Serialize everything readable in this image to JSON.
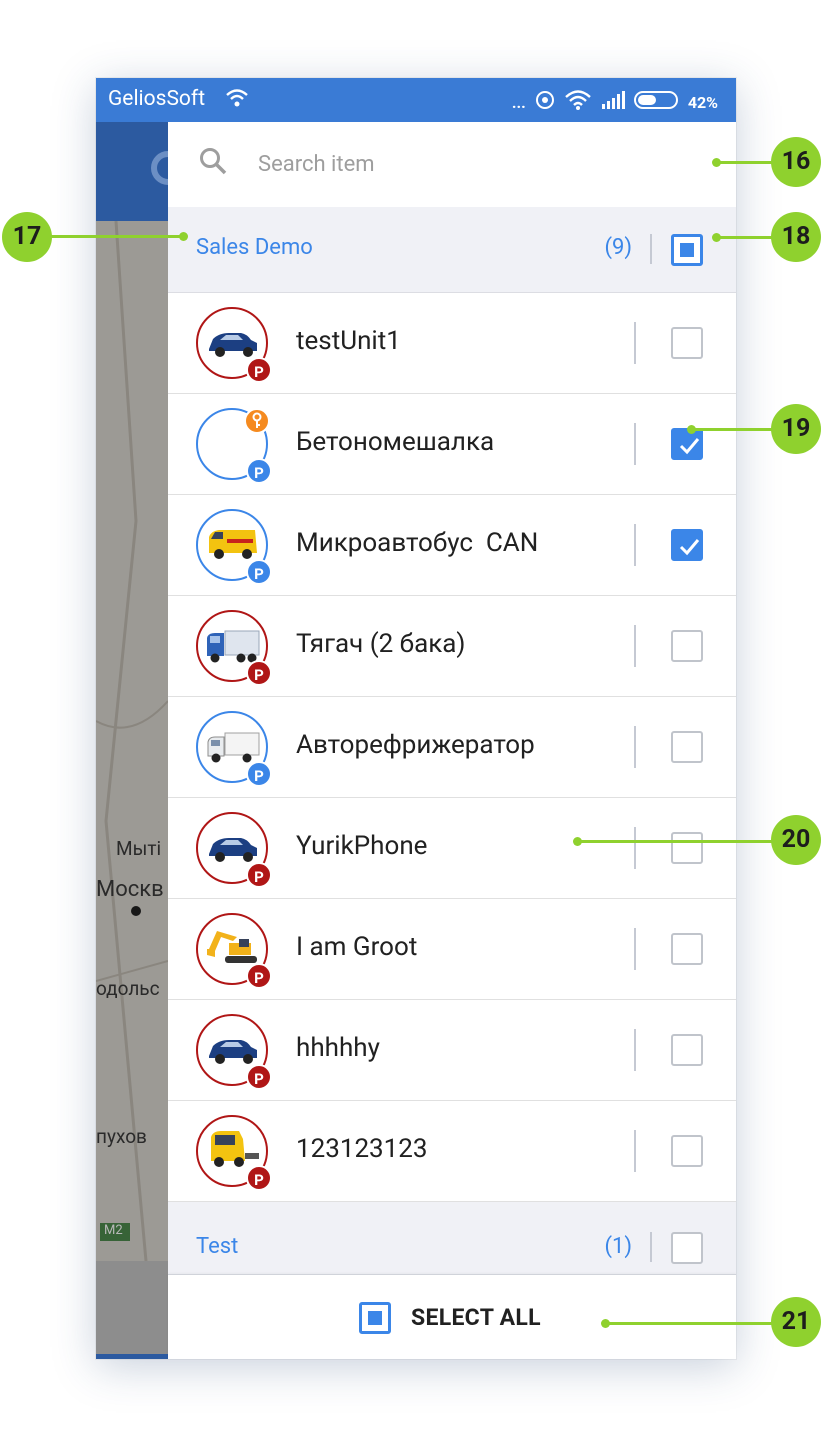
{
  "status_bar": {
    "carrier": "GeliosSoft",
    "battery": "42%",
    "dots": "..."
  },
  "map_labels": {
    "l1": "Мыті",
    "l2": "Москв",
    "l3": "одольс",
    "l4": "пухов",
    "road": "M2"
  },
  "search": {
    "placeholder": "Search item"
  },
  "groups": [
    {
      "name": "Sales Demo",
      "count": "(9)",
      "state": "partial",
      "items": [
        {
          "name": "testUnit1",
          "checked": false,
          "icon": "car-icon",
          "ring": "red"
        },
        {
          "name": "Бетономешалка",
          "checked": true,
          "icon": "key-icon",
          "ring": "blue"
        },
        {
          "name": "Микроавтобус  CAN",
          "checked": true,
          "icon": "van-icon",
          "ring": "blue"
        },
        {
          "name": "Тягач (2 бака)",
          "checked": false,
          "icon": "truck-icon",
          "ring": "red"
        },
        {
          "name": "Авторефрижератор",
          "checked": false,
          "icon": "reefer-truck-icon",
          "ring": "blue"
        },
        {
          "name": "YurikPhone",
          "checked": false,
          "icon": "car-icon",
          "ring": "red"
        },
        {
          "name": "I am Groot",
          "checked": false,
          "icon": "excavator-icon",
          "ring": "red"
        },
        {
          "name": "hhhhhy",
          "checked": false,
          "icon": "car-icon",
          "ring": "red"
        },
        {
          "name": "123123123",
          "checked": false,
          "icon": "tractor-unit-icon",
          "ring": "red"
        }
      ]
    },
    {
      "name": "Test",
      "count": "(1)",
      "state": "unchecked",
      "items": []
    }
  ],
  "parking_badge": "P",
  "select_all": {
    "label": "SELECT ALL"
  },
  "callouts": [
    "16",
    "17",
    "18",
    "19",
    "20",
    "21"
  ],
  "colors": {
    "accent": "#3b86e8",
    "status_bar": "#3a7bd5",
    "callout": "#8fd12e",
    "parking_red": "#b01616"
  }
}
